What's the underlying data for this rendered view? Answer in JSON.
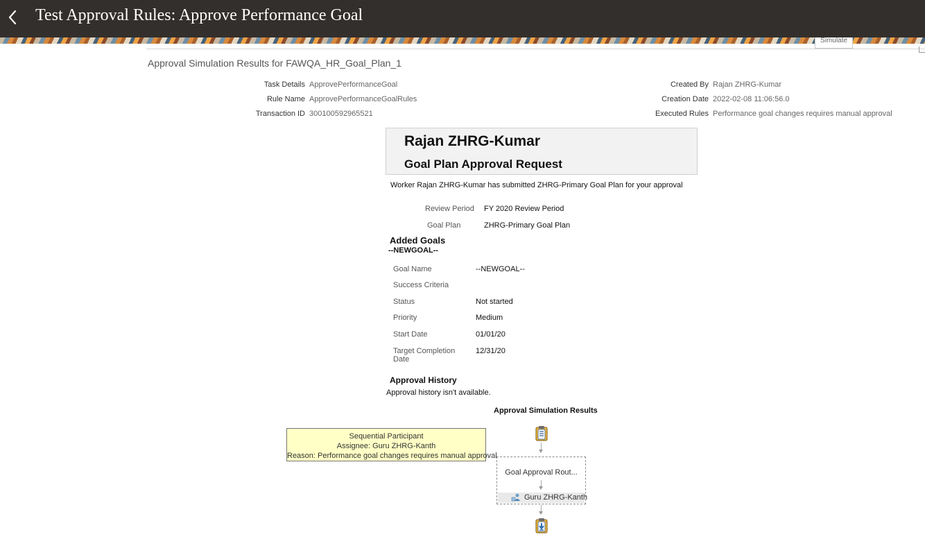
{
  "header": {
    "title": "Test Approval Rules: Approve Performance Goal"
  },
  "page": {
    "heading": "Approval Simulation Results for FAWQA_HR_Goal_Plan_1",
    "simulate_tab": "Simulate"
  },
  "details_left": [
    {
      "label": "Task Details",
      "value": "ApprovePerformanceGoal"
    },
    {
      "label": "Rule Name",
      "value": "ApprovePerformanceGoalRules"
    },
    {
      "label": "Transaction ID",
      "value": "300100592965521"
    }
  ],
  "details_right": [
    {
      "label": "Created By",
      "value": "Rajan ZHRG-Kumar"
    },
    {
      "label": "Creation Date",
      "value": "2022-02-08 11:06:56.0"
    },
    {
      "label": "Executed Rules",
      "value": "Performance goal changes requires manual approval"
    }
  ],
  "notification": {
    "name": "Rajan ZHRG-Kumar",
    "subtitle": "Goal Plan Approval Request",
    "message": "Worker Rajan ZHRG-Kumar has submitted ZHRG-Primary Goal Plan for your approval",
    "fields": [
      {
        "label": "Review Period",
        "value": "FY 2020 Review Period"
      },
      {
        "label": "Goal Plan",
        "value": "ZHRG-Primary Goal Plan"
      }
    ],
    "added_goals_heading": "Added Goals",
    "goal_title": "--NEWGOAL--",
    "goal_fields": [
      {
        "label": "Goal Name",
        "value": "--NEWGOAL--"
      },
      {
        "label": "Success Criteria",
        "value": ""
      },
      {
        "label": "Status",
        "value": "Not started"
      },
      {
        "label": "Priority",
        "value": "Medium"
      },
      {
        "label": "Start Date",
        "value": "01/01/20"
      },
      {
        "label": "Target Completion",
        "value": "12/31/20"
      }
    ],
    "goal_label_wrap": "Date",
    "history_heading": "Approval History",
    "history_text": "Approval history isn't available."
  },
  "simulation": {
    "heading": "Approval Simulation Results",
    "tooltip": {
      "line1": "Sequential Participant",
      "line2": "Assignee: Guru ZHRG-Kanth",
      "line3": "Reason: Performance goal changes requires manual approval"
    },
    "stage_label": "Goal Approval Rout...",
    "participant": "Guru ZHRG-Kanth"
  },
  "icons": {
    "back": "chevron-left-icon",
    "start": "clipboard-list-icon",
    "participant": "user-icon",
    "end": "clipboard-download-icon"
  }
}
